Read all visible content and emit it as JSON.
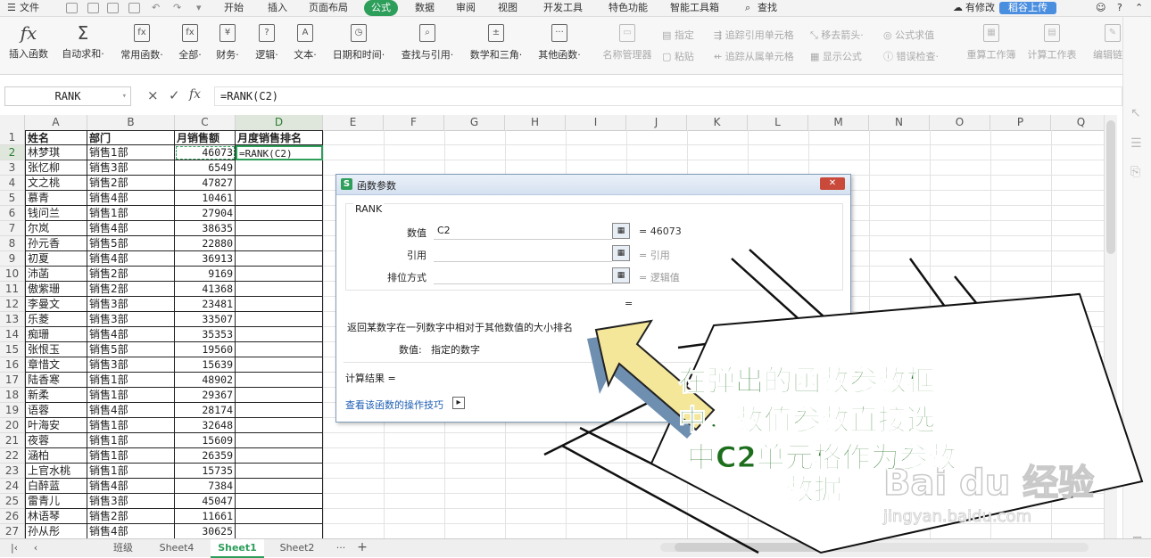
{
  "menubar": {
    "file_label": "文件",
    "tabs": [
      "开始",
      "插入",
      "页面布局",
      "公式",
      "数据",
      "审阅",
      "视图",
      "开发工具",
      "特色功能",
      "智能工具箱"
    ],
    "active_tab": "公式",
    "search_label": "查找",
    "modified_label": "有修改",
    "share_label": "稻谷上传"
  },
  "ribbon": {
    "buttons": [
      {
        "label": "插入函数",
        "icon": "fx"
      },
      {
        "label": "自动求和·",
        "icon": "Σ"
      },
      {
        "label": "常用函数·",
        "icon": "fx"
      },
      {
        "label": "全部·",
        "icon": "fx"
      },
      {
        "label": "财务·",
        "icon": "¥"
      },
      {
        "label": "逻辑·",
        "icon": "?"
      },
      {
        "label": "文本·",
        "icon": "A"
      },
      {
        "label": "日期和时间·",
        "icon": "◷"
      },
      {
        "label": "查找与引用·",
        "icon": "🔍"
      },
      {
        "label": "数学和三角·",
        "icon": "+-"
      },
      {
        "label": "其他函数·",
        "icon": "···"
      }
    ],
    "name_manager_label": "名称管理器",
    "define_label": "指定",
    "paste_label": "粘贴",
    "trace_precedents_label": "追踪引用单元格",
    "trace_dependents_label": "追踪从属单元格",
    "remove_arrows_label": "移去箭头·",
    "show_formulas_label": "显示公式",
    "eval_formula_label": "公式求值",
    "error_check_label": "错误检查·",
    "recalc_label": "重算工作簿",
    "calc_sheet_label": "计算工作表",
    "edit_links_label": "编辑链接"
  },
  "formula_bar": {
    "name_box": "RANK",
    "cancel_icon": "×",
    "confirm_icon": "✓",
    "fx_label": "fx",
    "formula": "=RANK(C2)"
  },
  "sheet": {
    "columns": [
      "A",
      "B",
      "C",
      "D",
      "E",
      "F",
      "G",
      "H",
      "I",
      "J",
      "K",
      "L",
      "M",
      "N",
      "O",
      "P",
      "Q"
    ],
    "headers": [
      "姓名",
      "部门",
      "月销售额",
      "月度销售排名"
    ],
    "rows": [
      [
        "林梦琪",
        "销售1部",
        "46073",
        "=RANK(C2)"
      ],
      [
        "张忆柳",
        "销售3部",
        "6549",
        ""
      ],
      [
        "文之桃",
        "销售2部",
        "47827",
        ""
      ],
      [
        "慕青",
        "销售4部",
        "10461",
        ""
      ],
      [
        "钱问兰",
        "销售1部",
        "27904",
        ""
      ],
      [
        "尔岚",
        "销售4部",
        "38635",
        ""
      ],
      [
        "孙元香",
        "销售5部",
        "22880",
        ""
      ],
      [
        "初夏",
        "销售4部",
        "36913",
        ""
      ],
      [
        "沛菡",
        "销售2部",
        "9169",
        ""
      ],
      [
        "傲紫珊",
        "销售2部",
        "41368",
        ""
      ],
      [
        "李曼文",
        "销售3部",
        "23481",
        ""
      ],
      [
        "乐菱",
        "销售3部",
        "33507",
        ""
      ],
      [
        "痴珊",
        "销售4部",
        "35353",
        ""
      ],
      [
        "张恨玉",
        "销售5部",
        "19560",
        ""
      ],
      [
        "章惜文",
        "销售3部",
        "15639",
        ""
      ],
      [
        "陆香寒",
        "销售1部",
        "48902",
        ""
      ],
      [
        "新柔",
        "销售1部",
        "29367",
        ""
      ],
      [
        "语蓉",
        "销售4部",
        "28174",
        ""
      ],
      [
        "叶海安",
        "销售1部",
        "32648",
        ""
      ],
      [
        "夜蓉",
        "销售1部",
        "15609",
        ""
      ],
      [
        "涵柏",
        "销售1部",
        "26359",
        ""
      ],
      [
        "上官水桃",
        "销售1部",
        "15735",
        ""
      ],
      [
        "白醉蓝",
        "销售4部",
        "7384",
        ""
      ],
      [
        "雷青儿",
        "销售3部",
        "45047",
        ""
      ],
      [
        "林语琴",
        "销售2部",
        "11661",
        ""
      ],
      [
        "孙从彤",
        "销售4部",
        "30625",
        ""
      ]
    ]
  },
  "dialog": {
    "title": "函数参数",
    "close_icon": "✕",
    "function_name": "RANK",
    "fields": [
      {
        "label": "数值",
        "value": "C2",
        "result": "= 46073"
      },
      {
        "label": "引用",
        "value": "",
        "result": "= 引用"
      },
      {
        "label": "排位方式",
        "value": "",
        "result": "= 逻辑值"
      }
    ],
    "equals": "=",
    "description": "返回某数字在一列数字中相对于其他数值的大小排名",
    "arg_label": "数值:",
    "arg_desc": "指定的数字",
    "calc_result_label": "计算结果 =",
    "help_link": "查看该函数的操作技巧"
  },
  "sheet_tabs": {
    "tabs": [
      "班级",
      "Sheet4",
      "Sheet1",
      "Sheet2"
    ],
    "active": "Sheet1",
    "more": "···",
    "add": "+"
  },
  "annotation": {
    "lines": [
      "在弹出的函数参数框",
      "中，数值参数直接选",
      "中C2单元格作为参数",
      "数据。"
    ],
    "watermark_main": "Bai du 经验",
    "watermark_sub": "jingyan.baidu.com"
  },
  "colors": {
    "accent_green": "#2e9e5b",
    "annotation_text": "#1c6e1c",
    "annotation_outline": "#ffffff",
    "arrow_fill": "#f5e79a",
    "arrow_shadow": "#6f8fb0"
  }
}
